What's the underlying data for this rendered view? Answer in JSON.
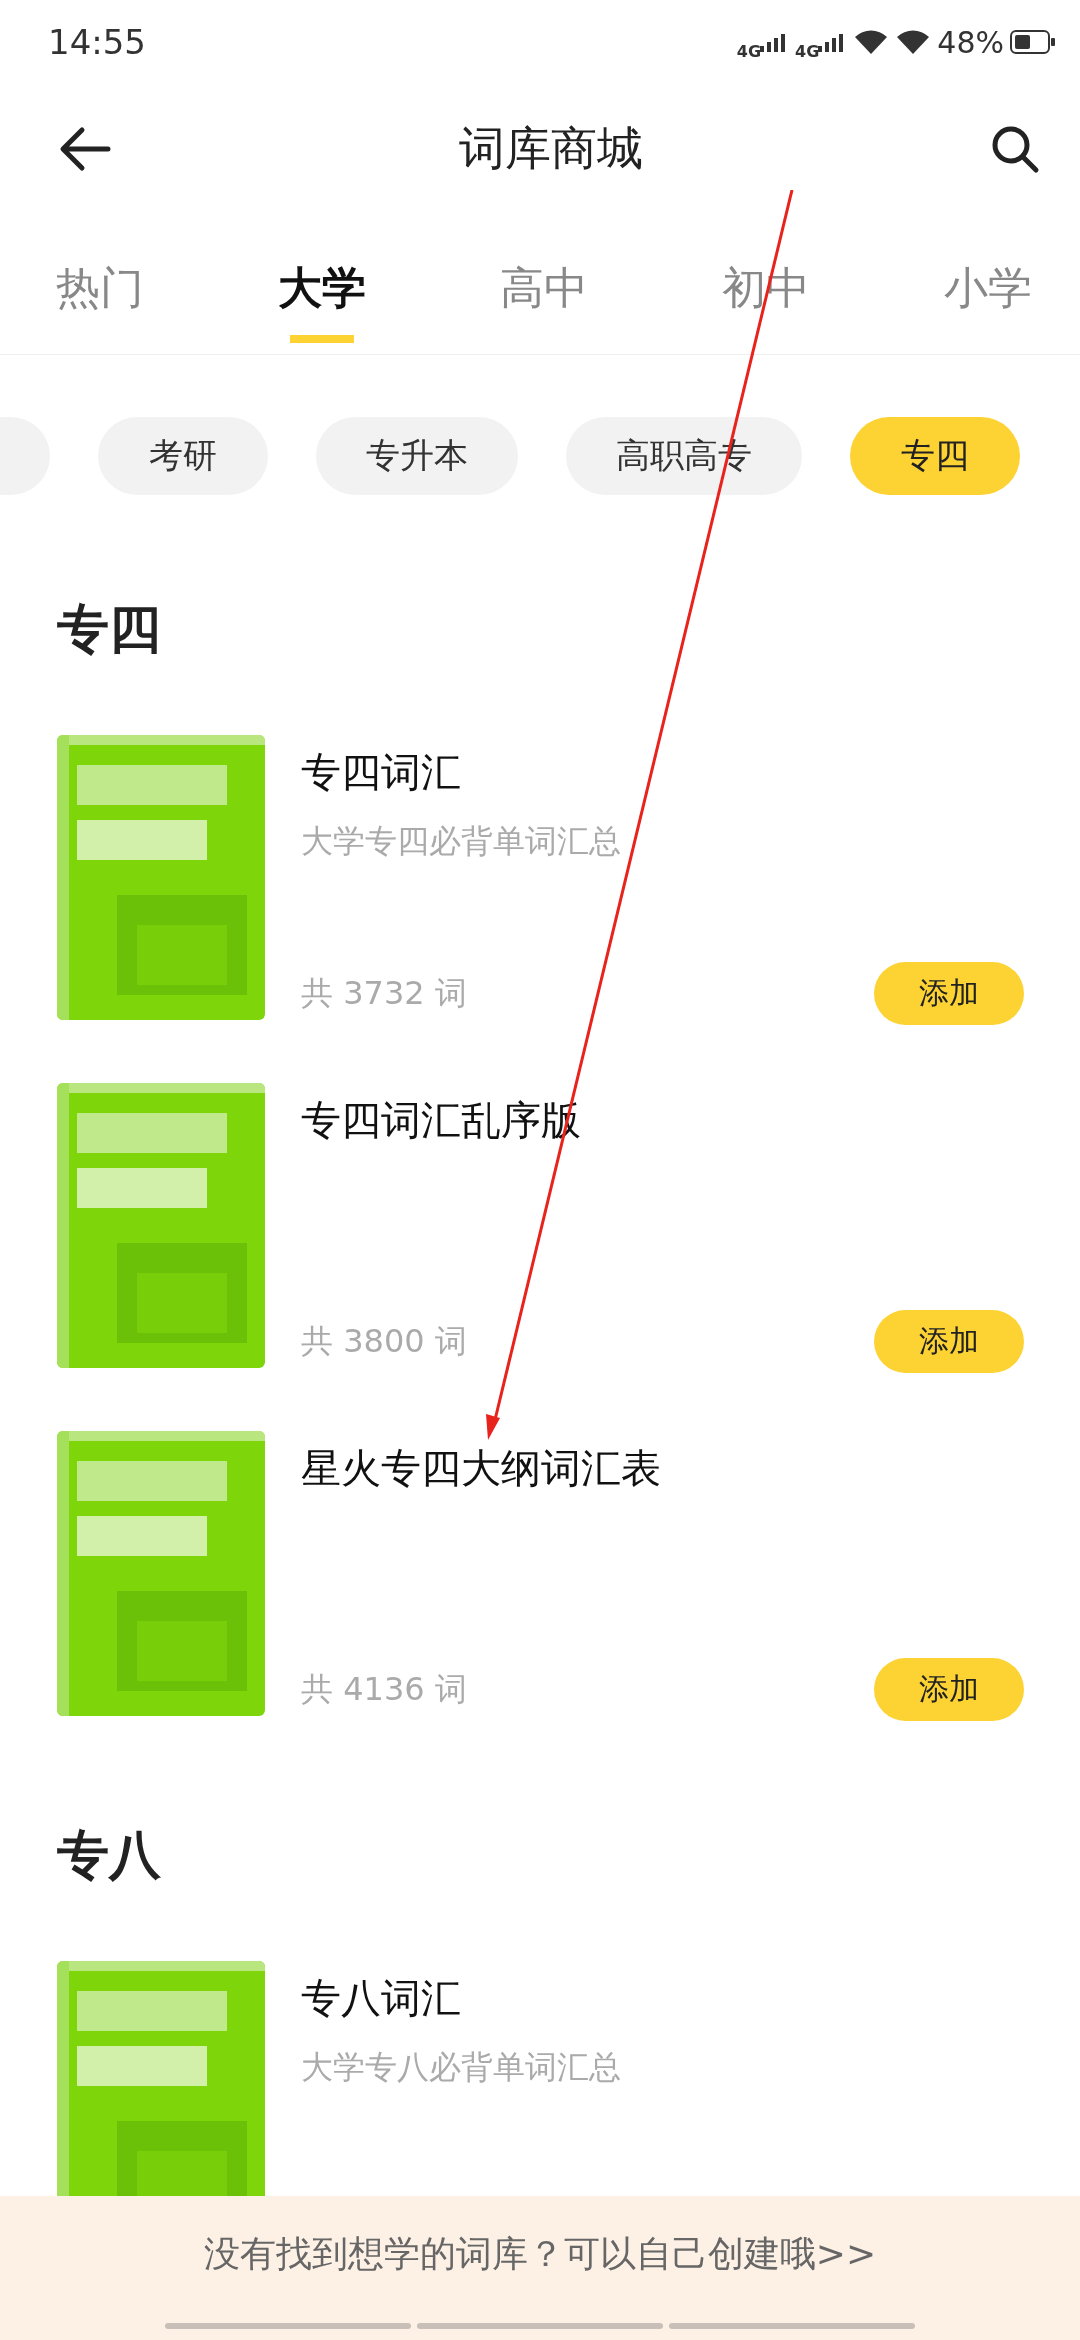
{
  "status_bar": {
    "time": "14:55",
    "network_1": "4G",
    "network_2": "4G",
    "battery": "48%"
  },
  "header": {
    "title": "词库商城"
  },
  "tabs": [
    {
      "label": "热门",
      "selected": false
    },
    {
      "label": "大学",
      "selected": true
    },
    {
      "label": "高中",
      "selected": false
    },
    {
      "label": "初中",
      "selected": false
    },
    {
      "label": "小学",
      "selected": false
    }
  ],
  "chips": [
    {
      "selected": false
    },
    {
      "label": "考研",
      "selected": false
    },
    {
      "label": "专升本",
      "selected": false
    },
    {
      "label": "高职高专",
      "selected": false
    },
    {
      "label": "专四",
      "selected": true
    }
  ],
  "sections": [
    {
      "title": "专四",
      "books": [
        {
          "title": "专四词汇",
          "subtitle": "大学专四必背单词汇总",
          "count": "共 3732 词",
          "button": "添加"
        },
        {
          "title": "专四词汇乱序版",
          "count": "共 3800 词",
          "button": "添加"
        },
        {
          "title": "星火专四大纲词汇表",
          "count": "共 4136 词",
          "button": "添加"
        }
      ]
    },
    {
      "title": "专八",
      "books": [
        {
          "title": "专八词汇",
          "subtitle": "大学专八必背单词汇总"
        }
      ]
    }
  ],
  "footer": {
    "text": "没有找到想学的词库？可以自己创建哦>>"
  }
}
